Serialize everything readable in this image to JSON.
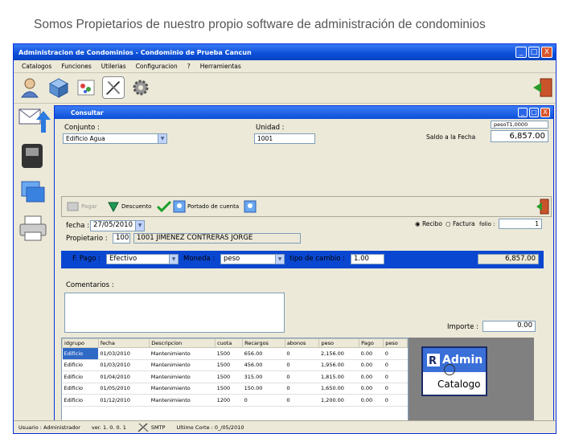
{
  "slide_title": "Somos Propietarios de nuestro propio software de administración de condominios",
  "window": {
    "title": "Administracion de Condominios - Condominio de Prueba Cancun",
    "minimize": "_",
    "maximize": "□",
    "close": "X"
  },
  "menu": [
    "Catalogos",
    "Funciones",
    "Utilerias",
    "Configuracion",
    "?",
    "Herramientas"
  ],
  "inner_window": {
    "title": "Consultar",
    "minimize": "_",
    "maximize": "□",
    "close": "X"
  },
  "form": {
    "condominio_label": "Conjunto :",
    "condominio_value": "Edificio Agua",
    "unidad_label": "Unidad :",
    "unidad_value": "1001",
    "saldo_label": "Saldo a la Fecha",
    "saldo_small": "pesoT1,0000",
    "saldo_value": "6,857.00",
    "tools": {
      "pagar": "Pagar",
      "descuento": "Descuento",
      "portado": "Portado de cuenta"
    },
    "fecha_label": "fecha :",
    "fecha_value": "27/05/2010",
    "recibo_label": "Recibo",
    "factura_label": "Factura",
    "folio_label": "folio :",
    "folio_value": "1",
    "propietario_label": "Propietario :",
    "propietario_id": "100",
    "propietario_name": "1001 JIMENEZ CONTRERAS JORGE",
    "fpago_label": "F. Pago :",
    "fpago_value": "Efectivo",
    "moneda_label": "Moneda :",
    "moneda_value": "peso",
    "tipo_cambio_label": "tipo de cambio :",
    "tipo_cambio_value": "1.00",
    "total_value": "6,857.00",
    "comentarios_label": "Comentarios :",
    "importe_label": "Importe :",
    "importe_value": "0.00"
  },
  "grid": {
    "headers": [
      "idgrupo",
      "fecha",
      "Descripcion",
      "cuota",
      "Recargos",
      "abonos",
      "peso",
      "Pago",
      "peso"
    ],
    "rows": [
      [
        "Edificio",
        "01/03/2010",
        "Mantenimiento",
        "1500",
        "656.00",
        "0",
        "2,156.00",
        "0.00",
        "0"
      ],
      [
        "Edificio",
        "01/03/2010",
        "Mantenimiento",
        "1500",
        "456.00",
        "0",
        "1,956.00",
        "0.00",
        "0"
      ],
      [
        "Edificio",
        "01/04/2010",
        "Mantenimiento",
        "1500",
        "315.00",
        "0",
        "1,815.00",
        "0.00",
        "0"
      ],
      [
        "Edificio",
        "01/05/2010",
        "Mantenimiento",
        "1500",
        "150.00",
        "0",
        "1,650.00",
        "0.00",
        "0"
      ],
      [
        "Edificio",
        "01/12/2010",
        "Mantenimiento",
        "1200",
        "0",
        "0",
        "1,200.00",
        "0.00",
        "0"
      ]
    ]
  },
  "admin_tile": {
    "top": "Admin",
    "bottom": "Catalogo"
  },
  "status": {
    "usuario": "Usuario : Administrador",
    "version": "ver. 1. 0. 0. 1",
    "smtp": "SMTP",
    "ultimo_corte": "Ultimo Corte : 0_/05/2010"
  }
}
